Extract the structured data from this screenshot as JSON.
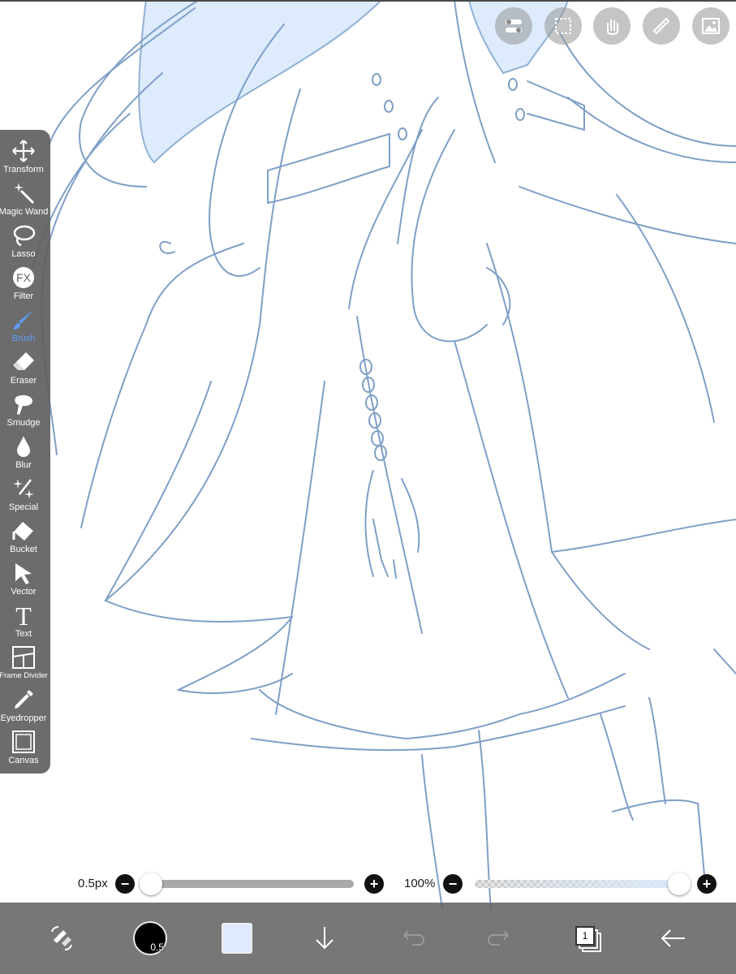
{
  "app": {
    "top_actions": [
      {
        "name": "layer-toggle-icon"
      },
      {
        "name": "selection-icon"
      },
      {
        "name": "hand-icon"
      },
      {
        "name": "ruler-icon"
      },
      {
        "name": "material-icon"
      }
    ]
  },
  "toolbar": {
    "active": "Brush",
    "tools": [
      {
        "label": "Transform",
        "icon": "move-arrows-icon"
      },
      {
        "label": "Magic Wand",
        "icon": "magic-wand-icon"
      },
      {
        "label": "Lasso",
        "icon": "lasso-icon"
      },
      {
        "label": "Filter",
        "icon": "fx-icon",
        "icon_text": "FX"
      },
      {
        "label": "Brush",
        "icon": "brush-icon"
      },
      {
        "label": "Eraser",
        "icon": "eraser-icon"
      },
      {
        "label": "Smudge",
        "icon": "smudge-icon"
      },
      {
        "label": "Blur",
        "icon": "drop-icon"
      },
      {
        "label": "Special",
        "icon": "sparkle-icon"
      },
      {
        "label": "Bucket",
        "icon": "bucket-icon"
      },
      {
        "label": "Vector",
        "icon": "pointer-icon"
      },
      {
        "label": "Text",
        "icon": "text-icon",
        "icon_text": "T"
      },
      {
        "label": "Frame Divider",
        "icon": "frame-divider-icon"
      },
      {
        "label": "Eyedropper",
        "icon": "eyedropper-icon"
      },
      {
        "label": "Canvas",
        "icon": "canvas-icon"
      }
    ]
  },
  "sliders": {
    "size": {
      "label": "0.5px",
      "value_fraction": 0.0
    },
    "opacity": {
      "label": "100%",
      "value_fraction": 1.0
    }
  },
  "bottom_bar": {
    "brush_size_badge": "0.5",
    "layer_count": "1",
    "current_color": "#ddebfc"
  },
  "colors": {
    "accent": "#5d9df5",
    "line_art": "#7f9fc7",
    "hair_fill": "#ddebfc"
  }
}
